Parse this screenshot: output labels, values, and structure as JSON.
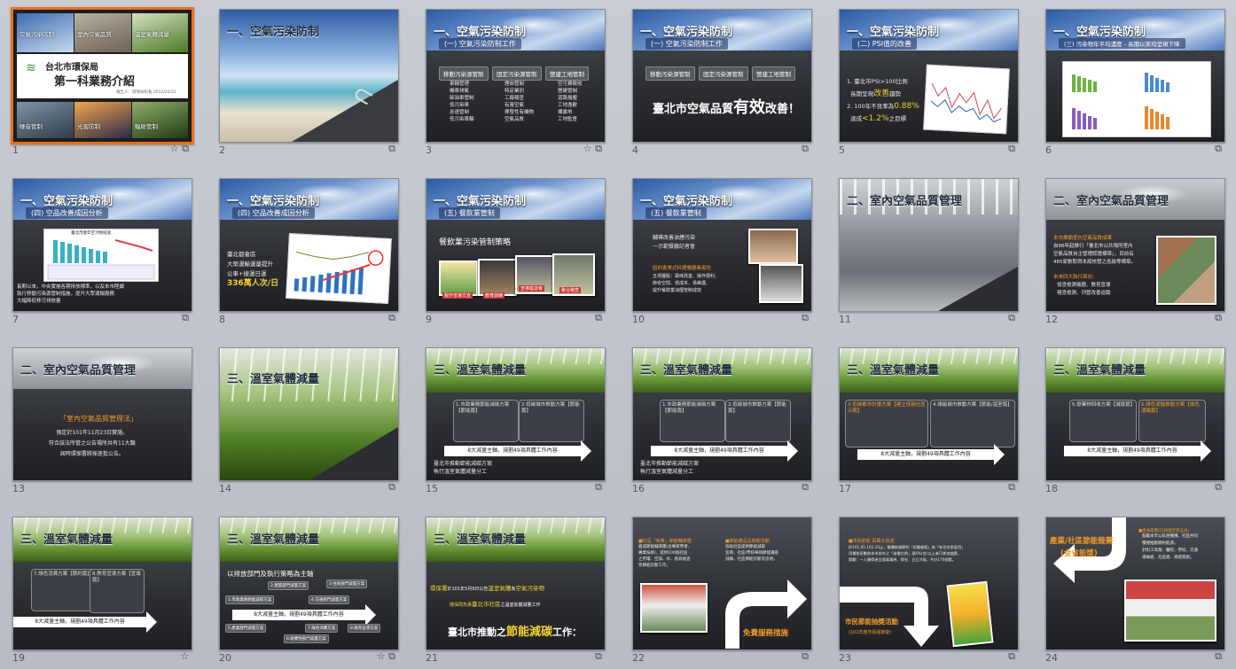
{
  "colors": {
    "selection": "#e8701a",
    "accent_yellow": "#f5d22c",
    "accent_orange": "#f09a2a"
  },
  "slides": [
    {
      "n": "1",
      "cover_labels": [
        "空氣污染防制",
        "室內空氣品質",
        "溫室氣體減量",
        "噪音管制",
        "光害防制",
        "輻射管制"
      ],
      "org": "台北市環保局",
      "title": "第一科業務介紹",
      "meta": "報告人：環保局科長 2012/10/22"
    },
    {
      "n": "2",
      "title": "一、空氣污染防制"
    },
    {
      "n": "3",
      "title": "一、空氣污染防制",
      "sub": "(一) 空氣污染防制工作",
      "pills": [
        "移動污染源管制",
        "固定污染源管制",
        "營建工地管制"
      ],
      "cols": [
        [
          "車輛管理",
          "機車排氣",
          "柴油車管制",
          "低污染車",
          "怠速管制",
          "低污染車輛"
        ],
        [
          "煙囪管制",
          "特定業別",
          "工廠稽查",
          "有害空氣",
          "揮發性有機物",
          "空氣品質"
        ],
        [
          "空污費徵收",
          "營建管制",
          "道路揚塵",
          "工地逸散",
          "裸露地",
          "工地監督"
        ]
      ]
    },
    {
      "n": "4",
      "title": "一、空氣污染防制",
      "sub": "(一) 空氣污染防制工作",
      "pills": [
        "移動污染源管制",
        "固定污染源管制",
        "營建工地管制"
      ],
      "text_pre": "臺北市空氣品質",
      "text_em": "有效",
      "text_post": "改善！"
    },
    {
      "n": "5",
      "title": "一、空氣污染防制",
      "sub": "(二) PSI值的改善",
      "line1": "1. 臺北市PSI>100比例",
      "line2": "長期呈現",
      "line2_em": "改善",
      "line2_post": "趨勢",
      "line3": "2. 100年不良率為",
      "line3_em": "0.88%",
      "line4": "達成",
      "line4_em": "<1.2%",
      "line4_post": "之目標"
    },
    {
      "n": "6",
      "title": "一、空氣污染防制",
      "sub": "(三) 污染物年平均濃度 - 長期以來均呈現下降"
    },
    {
      "n": "7",
      "title": "一、空氣污染防制",
      "sub": "(四) 空品改善成因分析",
      "chart_title": "臺北市歷年空污物排放",
      "lines": [
        "長期以來，中央實施各期排放標準，以及本市陸續",
        "執行移動污染源管制措施，提升大眾運輸服務",
        "大幅降低移污排放量"
      ]
    },
    {
      "n": "8",
      "title": "一、空氣污染防制",
      "sub": "(四) 空品改善成因分析",
      "lines": [
        "臺北都會區",
        "大眾運輸運量提升"
      ],
      "hl1": "公車+捷運日運",
      "hl2": "336萬人次/日"
    },
    {
      "n": "9",
      "title": "一、空氣污染防制",
      "sub": "(五) 餐飲業管制",
      "heading": "餐飲業污染管制策略",
      "captions": [
        "製作宣導文宣",
        "教育訓練",
        "宣導座談會",
        "聯合稽查"
      ]
    },
    {
      "n": "10",
      "title": "一、空氣污染防制",
      "sub": "(五) 餐飲業管制",
      "lines": [
        "輔導改善油煙污染",
        "一示範餐廳記者會"
      ],
      "hl": "紐約客美式料理餐廳業者佐",
      "lines2": [
        "五項優點：異味改善、操作便利、",
        "節省空間、低成本、易維護、",
        "提升餐飲業油煙管制成效"
      ]
    },
    {
      "n": "11",
      "title": "二、室內空氣品質管理"
    },
    {
      "n": "12",
      "title": "二、室內空氣品質管理",
      "hl": "本市推動室內空氣品質成果",
      "lines": [
        "自96年起推行「臺北市公共場所室內",
        "空氣品質自主管理認證標章」，目前有",
        "485家數取得本局核發之各級等標章。"
      ],
      "hl2": "未來四大執行面向：",
      "lines2": [
        "偵查檢測儀器、教育宣導",
        "稽查檢測、列管改善追蹤"
      ]
    },
    {
      "n": "13",
      "title": "二、室內空氣品質管理",
      "hl": "「室內空氣品質管理法」",
      "lines": [
        "預定於101年11月23日實施。",
        "符合該法所管之公告場所共有11大類",
        "屆時環保署將採逐批公告。"
      ]
    },
    {
      "n": "14",
      "title": "三、溫室氣體減量"
    },
    {
      "n": "15",
      "title": "三、溫室氣體減量",
      "boxes": [
        "1.市政業務節能減碳方案【節能篇】",
        "2.低碳城市推動方案【節能篇】"
      ],
      "arrow": "8大減量主軸，規劃49項具體工作內容",
      "lines": [
        "臺北市推動節能減碳方案",
        "執行溫室氣體減量分工"
      ]
    },
    {
      "n": "16",
      "title": "三、溫室氣體減量",
      "boxes": [
        "1.市政業務節能減碳方案【節能篇】",
        "2.低碳城市推動方案【節能篇】"
      ],
      "arrow": "8大減量主軸，規劃49項具體工作內容",
      "lines": [
        "臺北市推動節能減碳方案",
        "執行溫室氣體減量分工"
      ]
    },
    {
      "n": "17",
      "title": "三、溫室氣體減量",
      "boxes": [
        "3.低碳都市計畫方案【建立低碳社區示範】",
        "4.綠能城市推動方案【節能/溫室篇】"
      ],
      "arrow": "8大減量主軸，規劃49項具體工作內容"
    },
    {
      "n": "18",
      "title": "三、溫室氣體減量",
      "boxes": [
        "5.廢棄物回收方案【減廢篇】",
        "6.綠色運輸推動方案【綠色運輸篇】"
      ],
      "arrow": "8大減量主軸，規劃49項具體工作內容"
    },
    {
      "n": "19",
      "title": "三、溫室氣體減量",
      "boxes": [
        "7.綠色消費方案【節約篇】",
        "8.教育宣導方案【宣導篇】"
      ],
      "arrow": "8大減量主軸，規劃49項具體工作內容"
    },
    {
      "n": "20",
      "title": "三、溫室氣體減量",
      "heading": "以排放部門及執行策略為主軸",
      "arrow": "8大減量主軸，規劃49項具體工作內容",
      "pills": [
        "2.建築部門減量方案",
        "3.住商部門減量方案",
        "1.市政業務節能減碳方案",
        "4.交通部門減量方案",
        "5.產業部門減量方案",
        "6.廢棄物部門減量方案",
        "7.綠色消費方案",
        "8.教育宣導方案"
      ]
    },
    {
      "n": "21",
      "title": "三、溫室氣體減量",
      "line1_a": "環保署",
      "line1_b": "於101年5月9日公告",
      "line1_c": "溫室氣體",
      "line1_d": "為",
      "line1_e": "空氣污染物",
      "line2_a": "環保局負責",
      "line2_b": "臺北市社區",
      "line2_c": "之溫室氣體減量工作",
      "line3_a": "臺北市推動之",
      "line3_b": "節能減碳",
      "line3_c": "工作："
    },
    {
      "n": "22",
      "hl1": "■社區「免費」節能輔導團",
      "lines1": [
        "組成節能輔導團(含專家學者、",
        "專業技師)，提供100個社區",
        "之用電、空調、水、燈具檢查",
        "等節能診斷工作。"
      ],
      "hl2": "■節能產品及節能活動",
      "lines2": [
        "協助社區提供節能減碳",
        "宣導，社區/學校舉辦節能講座",
        "訓練，社區節能診斷及訪視。"
      ],
      "callout": "免費服務措施"
    },
    {
      "n": "23",
      "hl1": "■市民節能 百萬大放送",
      "lines1": [
        "於101.05-101.10止，電價依據節約「用電級距」為「有住宅家庭用」",
        "用電依家數依本市前年之「省電比例」達5%(含)以上者可參加抽獎，",
        "獎勵：一人獨得者全面兩萬券、得金、日立冷氣，共計176個獎。"
      ],
      "callout": "市民節能抽獎活動",
      "callout_sub": "(101年度市民組節能)"
    },
    {
      "n": "24",
      "banner1": "產業/社區節能競賽",
      "banner2": "(金省能獎)",
      "hl": "■金省能獎(已辦理至第五屆)",
      "lines": [
        "鼓勵本市公私營機構、社區共同",
        "積極推動節約能源。",
        "針對工商業、醫院、學校、交通",
        "運輸組、社區組、捐建築組。"
      ]
    }
  ]
}
